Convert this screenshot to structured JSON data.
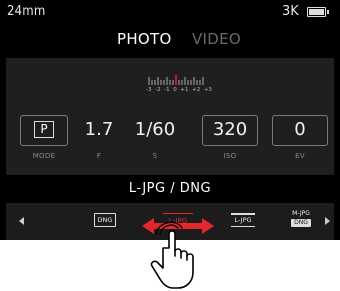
{
  "status": {
    "focal_length": "24mm",
    "resolution": "3K",
    "battery_icon": "battery-icon"
  },
  "modes": {
    "photo": "PHOTO",
    "video": "VIDEO",
    "active": "PHOTO"
  },
  "ev_scale": {
    "labels": [
      "-3",
      "-2",
      "-1",
      "0",
      "+1",
      "+2",
      "+3"
    ]
  },
  "params": [
    {
      "label": "MODE",
      "value": "P"
    },
    {
      "label": "F",
      "value": "1.7"
    },
    {
      "label": "S",
      "value": "1/60"
    },
    {
      "label": "ISO",
      "value": "320"
    },
    {
      "label": "EV",
      "value": "0"
    }
  ],
  "file_format": {
    "title": "L-JPG / DNG",
    "options": [
      "DNG",
      "L-JPG",
      "L-JPG",
      "M-JPG",
      "DNG"
    ],
    "selected_color": "#e3282b"
  },
  "gesture": {
    "icon": "swipe-hand-icon",
    "arrow_color": "#e3282b"
  }
}
